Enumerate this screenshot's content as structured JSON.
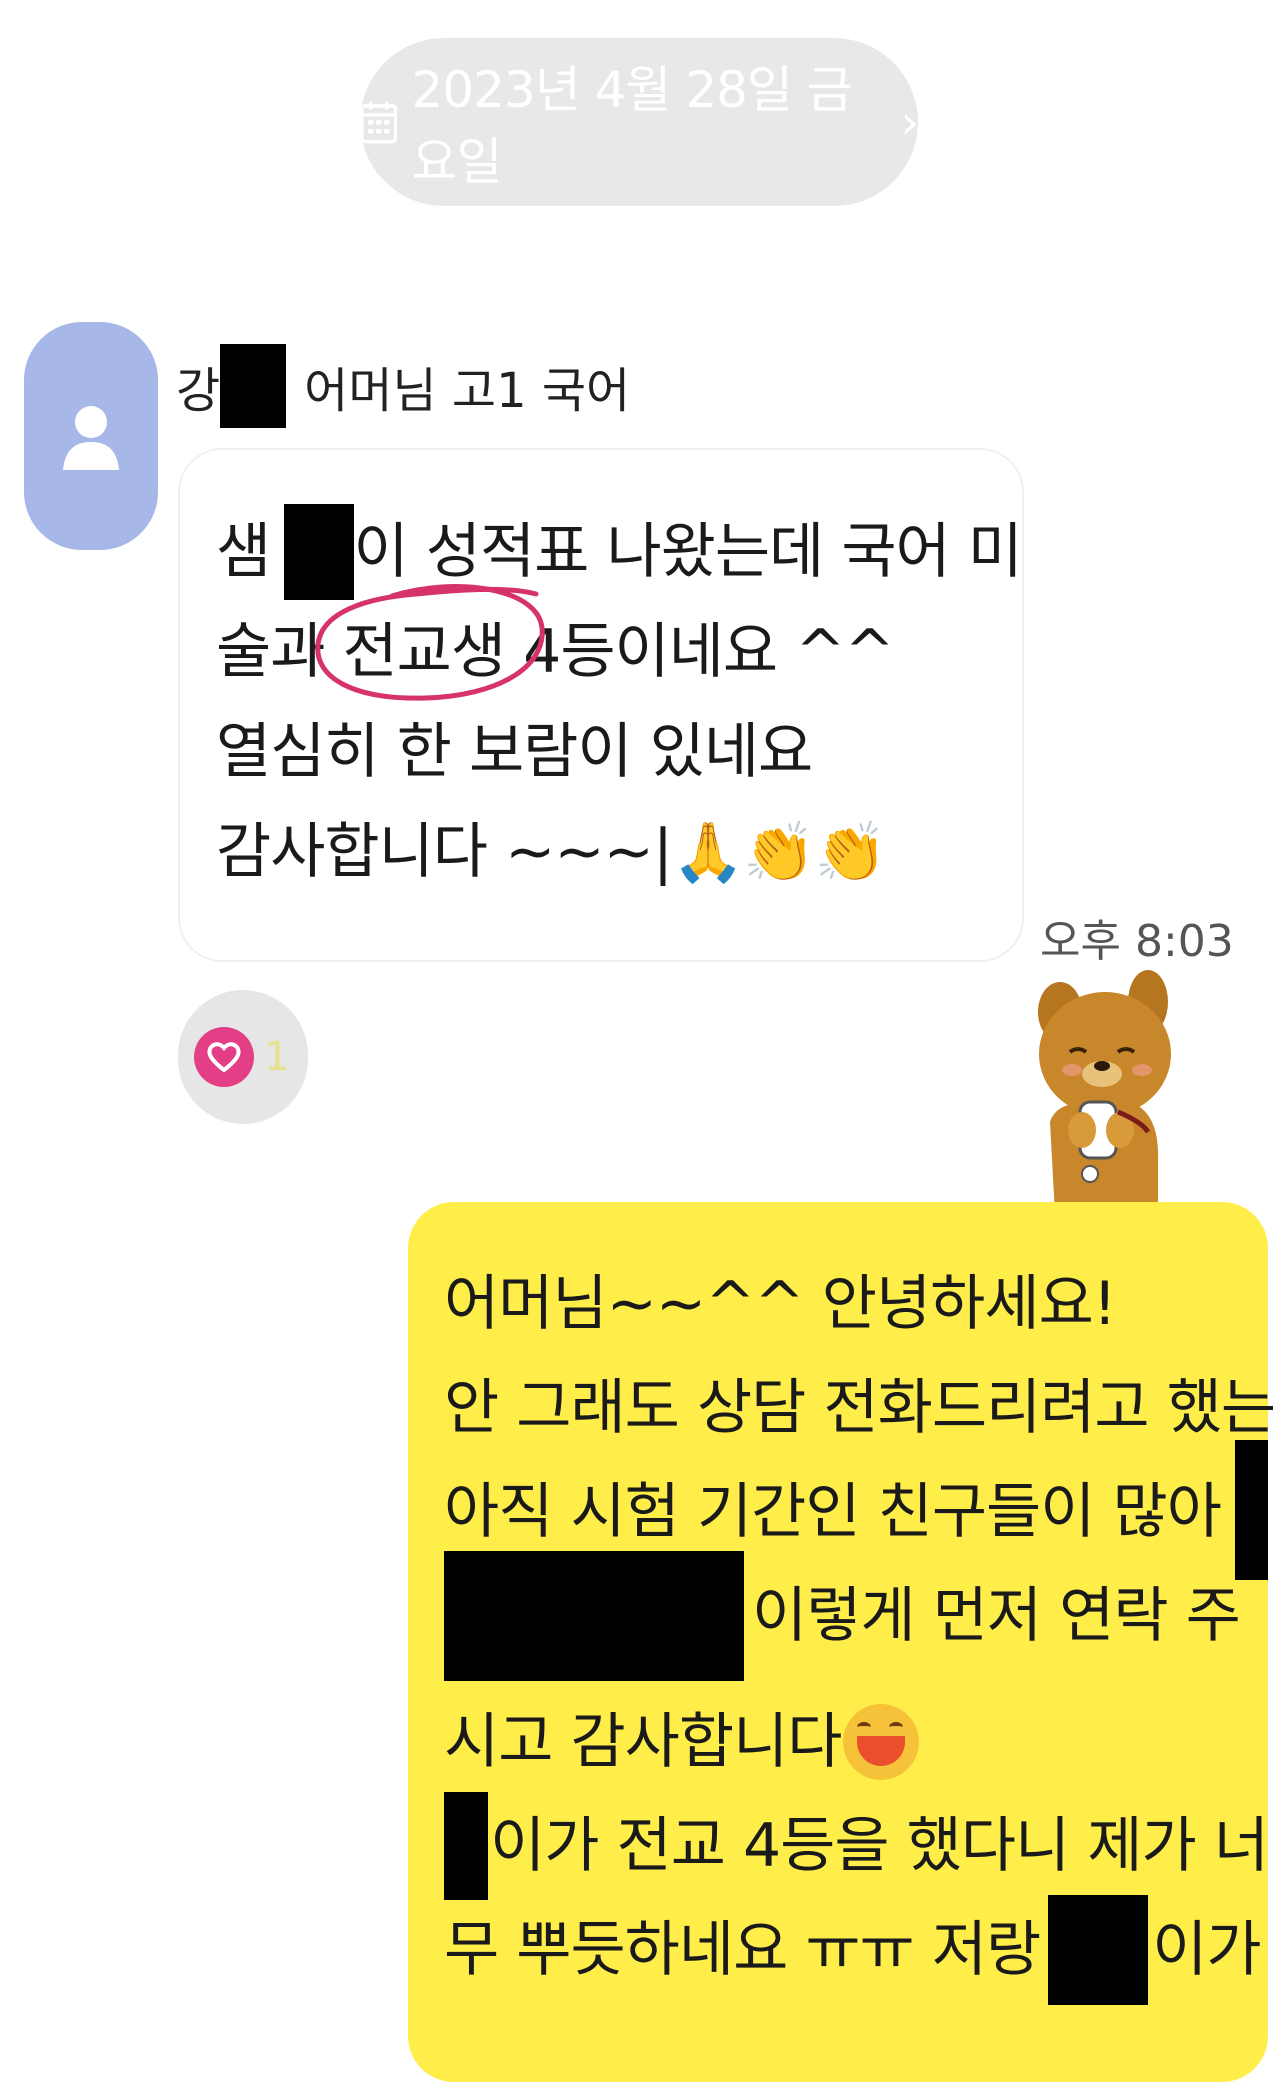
{
  "date_divider": {
    "label": "2023년 4월 28일 금요일",
    "chevron": "›",
    "icon": "calendar-icon"
  },
  "incoming": {
    "sender_prefix": "강",
    "sender_suffix": "어머님 고1 국어",
    "lines": {
      "l1_a": "샘",
      "l1_b": "이 성적표 나왔는데 국어 미",
      "l2": "술과 전교생 4등이네요 ^^",
      "l3": "열심히 한 보람이 있네요",
      "l4_text": "감사합니다 ~~~|",
      "l4_emoji": "🙏👏👏"
    },
    "highlight_color": "#d6336c",
    "time": "오후 8:03"
  },
  "reaction": {
    "icon": "heart-icon",
    "count": "1",
    "color": "#e43f86"
  },
  "outgoing": {
    "lines": {
      "l1": "어머님~~^^ 안녕하세요!",
      "l2": "안 그래도 상담 전화드리려고 했는데",
      "l3": "아직 시험 기간인 친구들이 많아",
      "l4": "이렇게 먼저 연락 주",
      "l5": "시고 감사합니다",
      "l6": "이가 전교 4등을 했다니 제가 너",
      "l7_a": "무 뿌듯하네요 ㅠㅠ 저랑",
      "l7_b": "이가"
    },
    "bubble_color": "#ffee4a"
  }
}
